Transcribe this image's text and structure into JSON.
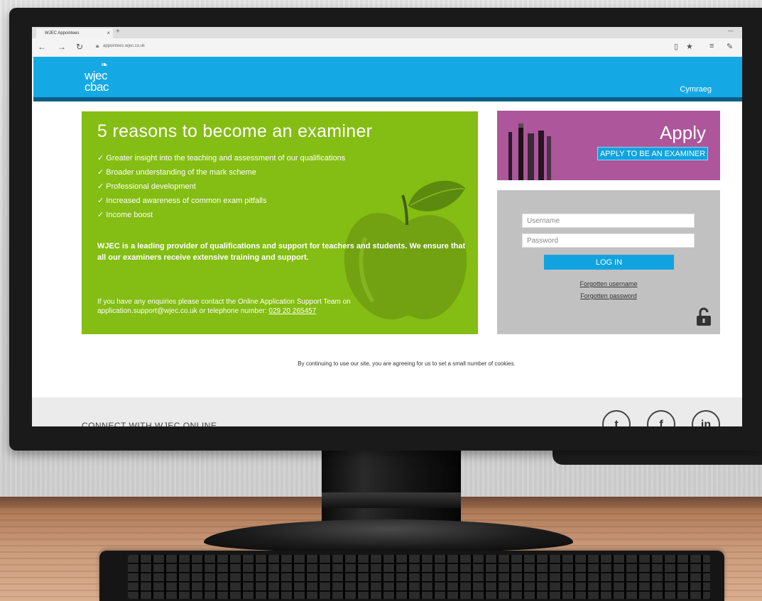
{
  "browser": {
    "tab_title": "WJEC Appointees",
    "tab_close": "×",
    "url": "appointees.wjec.co.uk"
  },
  "header": {
    "logo_line1": "wjec",
    "logo_line2": "cbac",
    "language_link": "Cymraeg",
    "brand_color": "#14a9e5"
  },
  "promo": {
    "title": "5 reasons to become an examiner",
    "reasons": [
      "✓ Greater insight into the teaching and assessment of our qualifications",
      "✓ Broader understanding of the mark scheme",
      "✓ Professional development",
      "✓ Increased awareness of common exam pitfalls",
      "✓ Income boost"
    ],
    "intro": "WJEC is a leading provider of qualifications and support for teachers and students. We ensure that all our examiners receive extensive training and support.",
    "enquiry_text": "If you have any enquiries please contact the Online Application Support Team on application.support@wjec.co.uk or telephone number: ",
    "phone": "029 20 265457",
    "color": "#84bd13"
  },
  "apply": {
    "title": "Apply",
    "button_label": "APPLY TO BE AN EXAMINER",
    "color": "#ad569b"
  },
  "login": {
    "username_placeholder": "Username",
    "password_placeholder": "Password",
    "button_label": "LOG IN",
    "forgot_username": "Forgotten username",
    "forgot_password": "Forgotten password"
  },
  "cookie_notice": "By continuing to use our site, you are agreeing for us to set a small number of cookies.",
  "footer": {
    "connect_label": "CONNECT WITH WJEC ONLINE",
    "social": [
      {
        "name": "twitter-icon",
        "glyph": "t"
      },
      {
        "name": "facebook-icon",
        "glyph": "f"
      },
      {
        "name": "linkedin-icon",
        "glyph": "in"
      }
    ]
  }
}
